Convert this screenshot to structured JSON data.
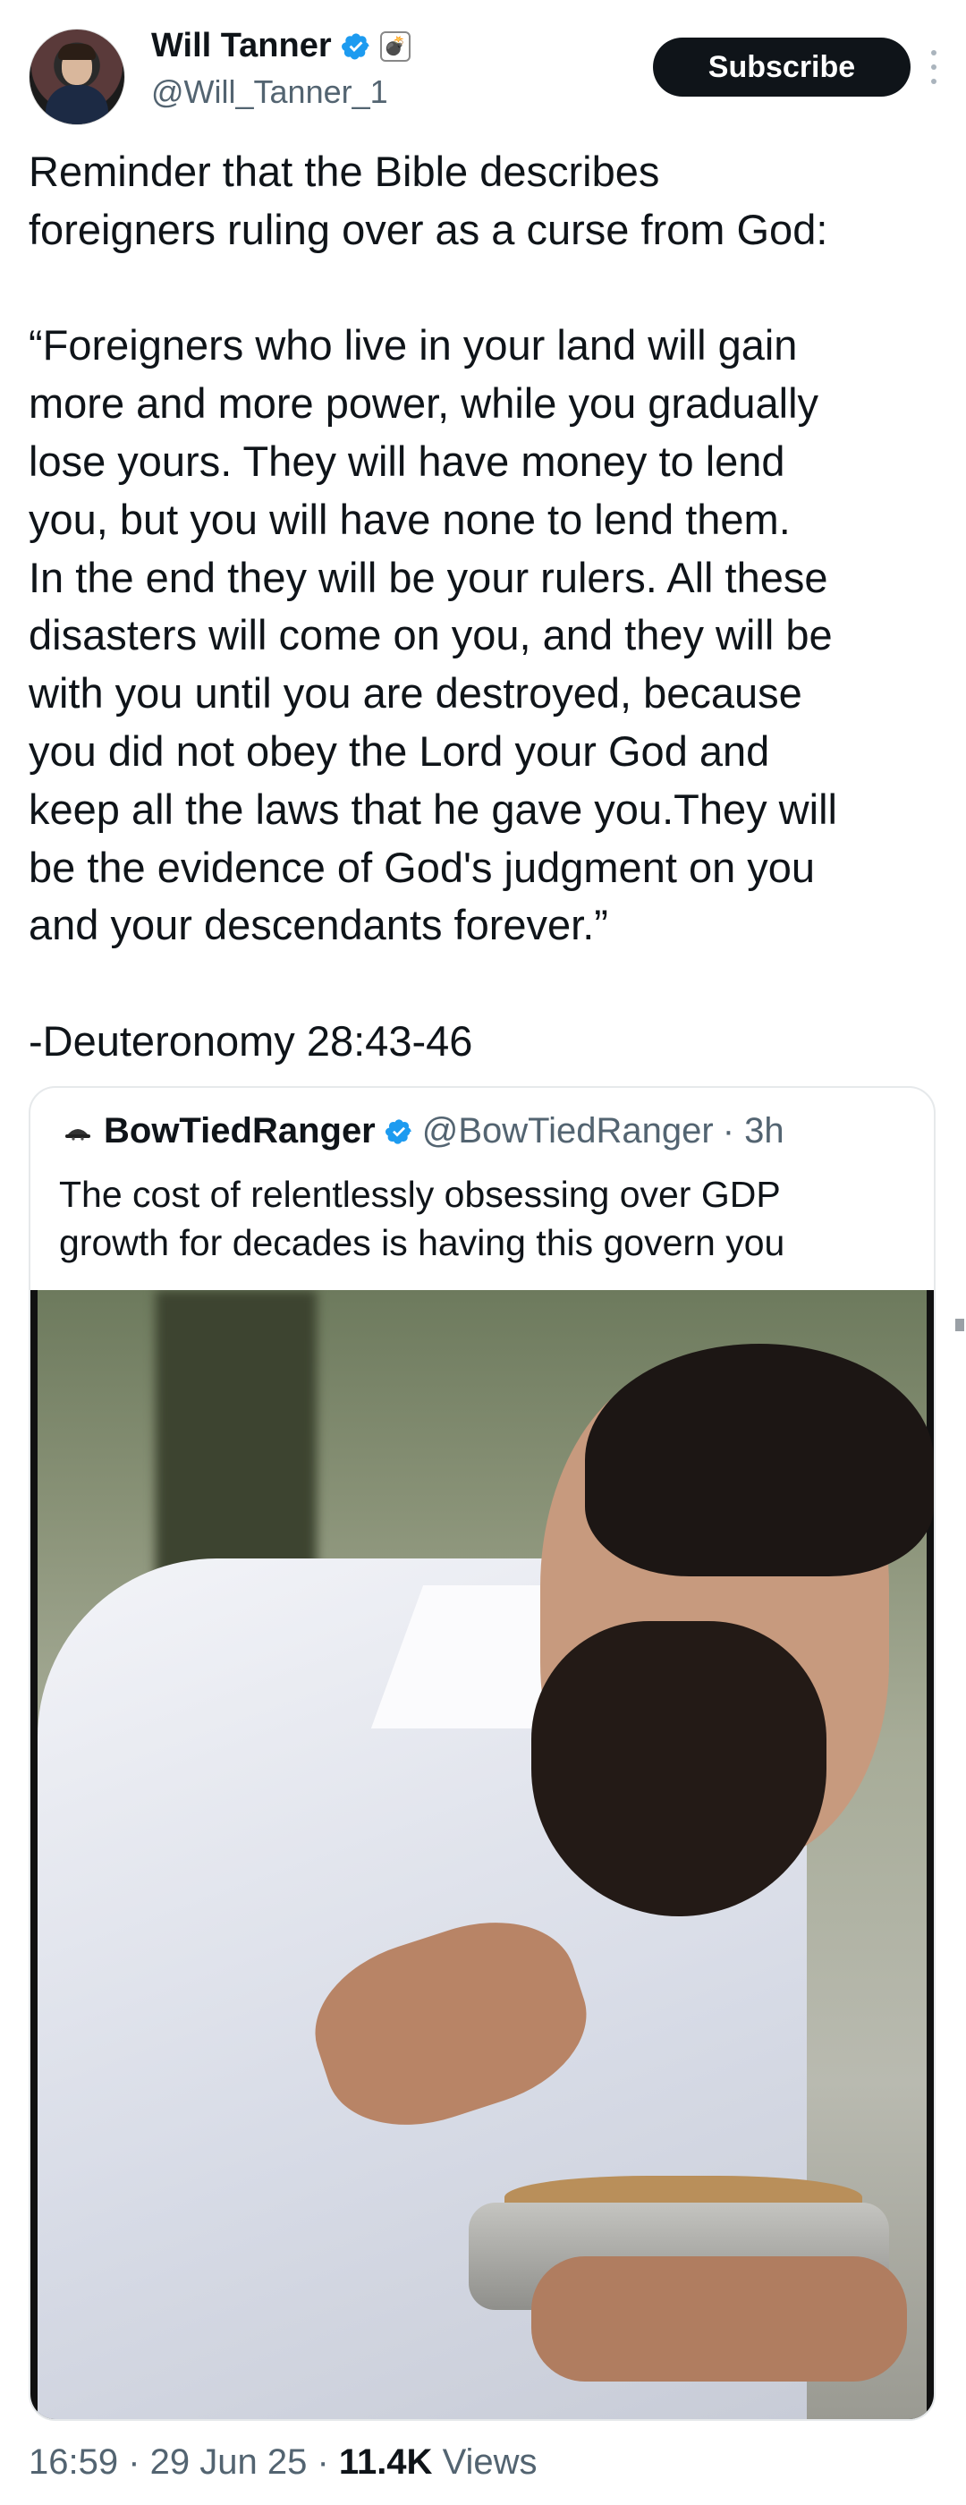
{
  "author": {
    "name": "Will Tanner",
    "handle": "@Will_Tanner_1",
    "badge_icon": "verified-badge-icon",
    "emoji_icon": "bomb-emoji-icon",
    "emoji_glyph": "💣"
  },
  "actions": {
    "subscribe_label": "Subscribe",
    "more_icon": "more-vertical-icon"
  },
  "tweet": {
    "text": "Reminder that the Bible describes\nforeigners ruling over as a curse from God:\n\n“Foreigners who live in your land will gain\nmore and more power, while you gradually\nlose yours. They will have money to lend\nyou, but you will have none to lend them.\nIn the end they will be your rulers. All these\ndisasters will come on you, and they will be\nwith you until you are destroyed, because\nyou did not obey the Lord your God and\nkeep all the laws that he gave you.They will\nbe the evidence of God's judgment on you\nand your descendants forever.”\n\n-Deuteronomy 28:43-46"
  },
  "quote": {
    "name": "BowTiedRanger",
    "handle": "@BowTiedRanger",
    "time": "· 3h",
    "text": "The cost of relentlessly obsessing over GDP\ngrowth for decades is having this govern you",
    "avatar_icon": "hat-icon"
  },
  "footer": {
    "time": "16:59",
    "date": "29 Jun 25",
    "views_count": "11.4K",
    "views_label": "Views",
    "sep": " · "
  },
  "colors": {
    "text": "#0f1419",
    "secondary": "#536471",
    "verified": "#1d9bf0",
    "border": "#e6e9eb"
  }
}
